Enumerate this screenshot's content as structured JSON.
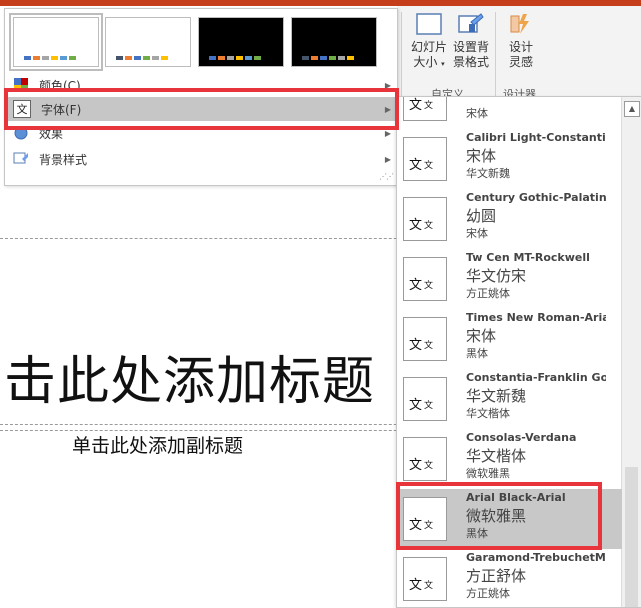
{
  "variants": [
    {
      "bg": "#ffffff",
      "swatches": [
        "#4472c4",
        "#ed7d31",
        "#a5a5a5",
        "#ffc000",
        "#5b9bd5",
        "#70ad47"
      ]
    },
    {
      "bg": "#ffffff",
      "swatches": [
        "#44546a",
        "#ed7d31",
        "#4472c4",
        "#70ad47",
        "#a5a5a5",
        "#ffc000"
      ]
    },
    {
      "bg": "#000000",
      "swatches": [
        "#4472c4",
        "#ed7d31",
        "#a5a5a5",
        "#ffc000",
        "#5b9bd5",
        "#70ad47"
      ]
    },
    {
      "bg": "#000000",
      "swatches": [
        "#44546a",
        "#ed7d31",
        "#4472c4",
        "#70ad47",
        "#a5a5a5",
        "#ffc000"
      ]
    }
  ],
  "menu": {
    "colors": "颜色(C)",
    "fonts": "字体(F)",
    "effects": "效果",
    "background": "背景样式"
  },
  "ribbon": {
    "slide_size_line1": "幻灯片",
    "slide_size_line2": "大小",
    "bg_format_line1": "设置背",
    "bg_format_line2": "景格式",
    "customize_group": "自定义",
    "designer_line1": "设计",
    "designer_line2": "灵感",
    "designer_group": "设计器"
  },
  "slide": {
    "title": "击此处添加标题",
    "subtitle": "单击此处添加副标题"
  },
  "fonts": [
    {
      "name": "",
      "heading": "",
      "body": "宋体",
      "thumb_big": "文",
      "thumb_small": "文"
    },
    {
      "name": "Calibri Light-Constantia",
      "heading": "宋体",
      "body": "华文新魏",
      "thumb_big": "文",
      "thumb_small": "文"
    },
    {
      "name": "Century Gothic-Palatin...",
      "heading": "幼圆",
      "body": "宋体",
      "thumb_big": "文",
      "thumb_small": "文"
    },
    {
      "name": "Tw Cen MT-Rockwell",
      "heading": "华文仿宋",
      "body": "方正姚体",
      "thumb_big": "文",
      "thumb_small": "文"
    },
    {
      "name": "Times New Roman-Arial",
      "heading": "宋体",
      "body": "黑体",
      "thumb_big": "文",
      "thumb_small": "文"
    },
    {
      "name": "Constantia-Franklin Go...",
      "heading": "华文新魏",
      "body": "华文楷体",
      "thumb_big": "文",
      "thumb_small": "文"
    },
    {
      "name": "Consolas-Verdana",
      "heading": "华文楷体",
      "body": "微软雅黑",
      "thumb_big": "文",
      "thumb_small": "文"
    },
    {
      "name": "Arial Black-Arial",
      "heading": "微软雅黑",
      "body": "黑体",
      "thumb_big": "文",
      "thumb_small": "文"
    },
    {
      "name": "Garamond-TrebuchetMs",
      "heading": "方正舒体",
      "body": "方正姚体",
      "thumb_big": "文",
      "thumb_small": "文"
    }
  ],
  "colors": {
    "highlight": "#e8343b",
    "accent": "#c43e1c",
    "selected_bg": "#c6c6c6"
  }
}
